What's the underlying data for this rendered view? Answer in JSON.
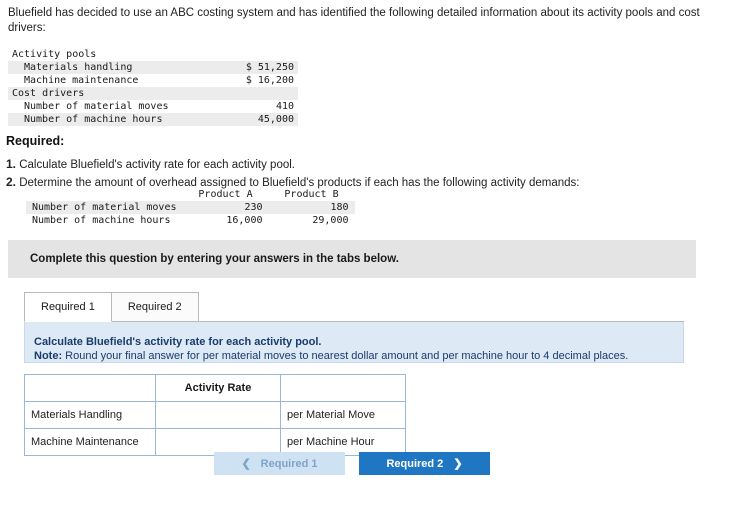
{
  "intro": "Bluefield has decided to use an ABC costing system and has identified the following detailed information about its activity pools and cost drivers:",
  "cost_table": {
    "rows": [
      {
        "label": "Activity pools",
        "value": "",
        "indent": false,
        "shade": false
      },
      {
        "label": "Materials handling",
        "value": "$ 51,250",
        "indent": true,
        "shade": true
      },
      {
        "label": "Machine maintenance",
        "value": "$ 16,200",
        "indent": true,
        "shade": false
      },
      {
        "label": "Cost drivers",
        "value": "",
        "indent": false,
        "shade": true
      },
      {
        "label": "Number of material moves",
        "value": "410",
        "indent": true,
        "shade": false
      },
      {
        "label": "Number of machine hours",
        "value": "45,000",
        "indent": true,
        "shade": true
      }
    ]
  },
  "required_heading": "Required:",
  "requirements": [
    {
      "num": "1.",
      "text": "Calculate Bluefield's activity rate for each activity pool."
    },
    {
      "num": "2.",
      "text": "Determine the amount of overhead assigned to Bluefield's products if each has the following activity demands:"
    }
  ],
  "demand_table": {
    "headers": [
      "",
      "Product A",
      "Product B"
    ],
    "rows": [
      {
        "label": "Number of material moves",
        "a": "230",
        "b": "180",
        "shade": true
      },
      {
        "label": "Number of machine hours",
        "a": "16,000",
        "b": "29,000",
        "shade": false
      }
    ]
  },
  "banner_text": "Complete this question by entering your answers in the tabs below.",
  "tabs": [
    {
      "label": "Required 1",
      "active": true
    },
    {
      "label": "Required 2",
      "active": false
    }
  ],
  "panel": {
    "line1": "Calculate Bluefield's activity rate for each activity pool.",
    "note_label": "Note:",
    "note_text": " Round your final answer for per material moves to nearest dollar amount and per machine hour to 4 decimal places."
  },
  "answer_grid": {
    "header": "Activity Rate",
    "rows": [
      {
        "label": "Materials Handling",
        "value": "",
        "unit": "per Material Move"
      },
      {
        "label": "Machine Maintenance",
        "value": "",
        "unit": "per Machine Hour"
      }
    ]
  },
  "nav": {
    "prev_label": "Required 1",
    "prev_icon": "chevron-left-icon",
    "next_label": "Required 2",
    "next_icon": "chevron-right-icon"
  },
  "colors": {
    "accent": "#1f76c2",
    "panel_bg": "#ddeaf6",
    "grid_header": "#cfe2f3",
    "banner_bg": "#e4e4e4"
  }
}
